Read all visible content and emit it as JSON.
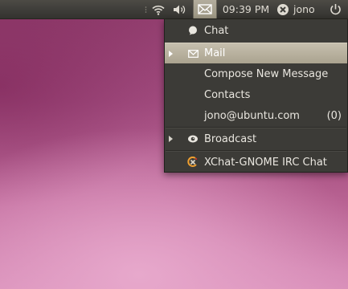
{
  "panel": {
    "clock": "09:39 PM",
    "username": "jono",
    "icons": [
      "wifi-icon",
      "volume-icon",
      "mail-icon",
      "user-status-icon",
      "power-icon"
    ]
  },
  "menu": {
    "items": [
      {
        "label": "Chat",
        "icon": "chat-bubble-icon"
      },
      {
        "label": "Mail",
        "icon": "envelope-icon",
        "selected": true,
        "has_submenu": true
      },
      {
        "label": "Compose New Message"
      },
      {
        "label": "Contacts"
      },
      {
        "label": "jono@ubuntu.com",
        "count": "(0)"
      },
      {
        "label": "Broadcast",
        "icon": "broadcast-icon",
        "has_submenu": true
      },
      {
        "label": "XChat-GNOME IRC Chat",
        "icon": "xchat-icon"
      }
    ]
  },
  "colors": {
    "panel_bg": "#3f3e3a",
    "menu_bg": "#3c3b37",
    "selected_bg": "#b7b09e",
    "text": "#e9e6df"
  }
}
